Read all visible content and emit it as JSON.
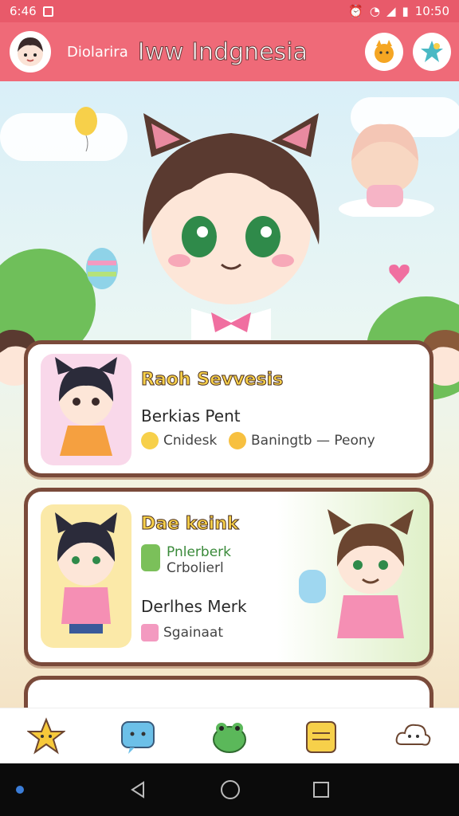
{
  "status_bar": {
    "time_left": "6:46",
    "time_right": "10:50"
  },
  "header": {
    "brand": "Diolarira",
    "title": "Iww Indgnesia"
  },
  "cards": [
    {
      "title": "Raoh Sevvesis",
      "subtitle": "Berkias Pent",
      "meta1": "Cnidesk",
      "meta2": "Baningtb — Peony"
    },
    {
      "title": "Dae keink",
      "line1": "Pnlerberk",
      "line2": "Crbolierl",
      "subtitle": "Derlhes Merk",
      "meta1": "Sgainaat"
    }
  ],
  "colors": {
    "accent": "#ef6a78",
    "card_border": "#7a4a3a",
    "title_yellow": "#f7d04a"
  },
  "icons": {
    "nav": [
      "star-icon",
      "chat-icon",
      "frog-icon",
      "note-icon",
      "cloud-icon"
    ]
  }
}
